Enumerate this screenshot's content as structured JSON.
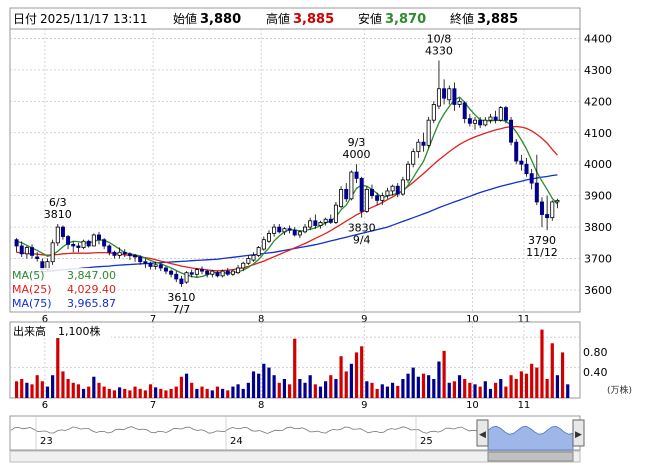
{
  "header": {
    "date_label": "日付",
    "date_value": "2025/11/17 13:11",
    "open_label": "始値",
    "open_value": "3,880",
    "high_label": "高値",
    "high_value": "3,885",
    "low_label": "安値",
    "low_value": "3,870",
    "close_label": "終値",
    "close_value": "3,885"
  },
  "colors": {
    "up": "#d00000",
    "down": "#00008b",
    "ma5": "#2e8b2e",
    "ma25": "#e02020",
    "ma75": "#1030d0",
    "grid": "#c8c8c8",
    "navigator_fill": "#9fb6e8"
  },
  "chart_data": [
    {
      "type": "candlestick",
      "x_months": [
        "6",
        "7",
        "8",
        "9",
        "10",
        "11"
      ],
      "y_ticks": [
        3600,
        3700,
        3800,
        3900,
        4000,
        4100,
        4200,
        4300,
        4400
      ],
      "ylim": [
        3530,
        4430
      ],
      "grid": true,
      "legend": [
        {
          "name": "MA(5)",
          "value": "3,847.00"
        },
        {
          "name": "MA(25)",
          "value": "4,029.40"
        },
        {
          "name": "MA(75)",
          "value": "3,965.87"
        }
      ],
      "annotations": [
        {
          "date": "6/3",
          "value": "3810",
          "position": "above"
        },
        {
          "date": "7/7",
          "value": "3610",
          "position": "below"
        },
        {
          "date": "9/3",
          "value": "4000",
          "position": "above"
        },
        {
          "date": "9/4",
          "value": "3830",
          "position": "below"
        },
        {
          "date": "10/8",
          "value": "4330",
          "position": "above"
        },
        {
          "date": "11/12",
          "value": "3790",
          "position": "below"
        }
      ],
      "candles": [
        [
          3760,
          3765,
          3720,
          3740
        ],
        [
          3740,
          3755,
          3705,
          3715
        ],
        [
          3715,
          3740,
          3700,
          3735
        ],
        [
          3735,
          3745,
          3700,
          3710
        ],
        [
          3705,
          3720,
          3690,
          3700
        ],
        [
          3690,
          3700,
          3650,
          3665
        ],
        [
          3665,
          3700,
          3660,
          3690
        ],
        [
          3690,
          3760,
          3680,
          3750
        ],
        [
          3750,
          3810,
          3740,
          3800
        ],
        [
          3800,
          3805,
          3760,
          3770
        ],
        [
          3770,
          3775,
          3730,
          3745
        ],
        [
          3745,
          3755,
          3720,
          3740
        ],
        [
          3740,
          3750,
          3720,
          3735
        ],
        [
          3735,
          3760,
          3730,
          3755
        ],
        [
          3755,
          3760,
          3735,
          3740
        ],
        [
          3740,
          3780,
          3740,
          3775
        ],
        [
          3775,
          3785,
          3745,
          3760
        ],
        [
          3760,
          3765,
          3730,
          3740
        ],
        [
          3740,
          3745,
          3710,
          3720
        ],
        [
          3720,
          3725,
          3700,
          3710
        ],
        [
          3710,
          3735,
          3700,
          3720
        ],
        [
          3720,
          3730,
          3705,
          3715
        ],
        [
          3715,
          3720,
          3695,
          3710
        ],
        [
          3710,
          3715,
          3690,
          3705
        ],
        [
          3705,
          3710,
          3680,
          3690
        ],
        [
          3690,
          3700,
          3670,
          3685
        ],
        [
          3685,
          3690,
          3665,
          3675
        ],
        [
          3675,
          3690,
          3665,
          3680
        ],
        [
          3680,
          3685,
          3660,
          3670
        ],
        [
          3670,
          3675,
          3650,
          3660
        ],
        [
          3660,
          3665,
          3640,
          3650
        ],
        [
          3650,
          3660,
          3625,
          3635
        ],
        [
          3635,
          3645,
          3610,
          3620
        ],
        [
          3625,
          3660,
          3620,
          3655
        ],
        [
          3655,
          3665,
          3640,
          3650
        ],
        [
          3650,
          3670,
          3640,
          3665
        ],
        [
          3665,
          3675,
          3650,
          3660
        ],
        [
          3660,
          3665,
          3640,
          3650
        ],
        [
          3650,
          3665,
          3640,
          3660
        ],
        [
          3655,
          3660,
          3640,
          3645
        ],
        [
          3645,
          3665,
          3640,
          3660
        ],
        [
          3660,
          3670,
          3645,
          3650
        ],
        [
          3650,
          3665,
          3645,
          3660
        ],
        [
          3655,
          3680,
          3650,
          3670
        ],
        [
          3670,
          3690,
          3660,
          3685
        ],
        [
          3685,
          3710,
          3680,
          3700
        ],
        [
          3695,
          3720,
          3690,
          3710
        ],
        [
          3710,
          3740,
          3705,
          3735
        ],
        [
          3730,
          3770,
          3725,
          3760
        ],
        [
          3755,
          3790,
          3750,
          3780
        ],
        [
          3780,
          3810,
          3770,
          3800
        ],
        [
          3800,
          3810,
          3780,
          3785
        ],
        [
          3785,
          3800,
          3775,
          3795
        ],
        [
          3795,
          3805,
          3780,
          3790
        ],
        [
          3790,
          3800,
          3770,
          3775
        ],
        [
          3775,
          3790,
          3765,
          3785
        ],
        [
          3785,
          3810,
          3780,
          3800
        ],
        [
          3800,
          3830,
          3790,
          3820
        ],
        [
          3820,
          3840,
          3795,
          3805
        ],
        [
          3805,
          3820,
          3795,
          3815
        ],
        [
          3815,
          3830,
          3805,
          3825
        ],
        [
          3825,
          3840,
          3810,
          3815
        ],
        [
          3815,
          3880,
          3810,
          3870
        ],
        [
          3865,
          3930,
          3860,
          3920
        ],
        [
          3920,
          3940,
          3880,
          3890
        ],
        [
          3890,
          3980,
          3885,
          3975
        ],
        [
          3975,
          4000,
          3940,
          3955
        ],
        [
          3955,
          3960,
          3830,
          3850
        ],
        [
          3850,
          3930,
          3845,
          3920
        ],
        [
          3920,
          3935,
          3890,
          3900
        ],
        [
          3900,
          3910,
          3870,
          3885
        ],
        [
          3885,
          3910,
          3870,
          3900
        ],
        [
          3900,
          3925,
          3890,
          3915
        ],
        [
          3915,
          3935,
          3900,
          3930
        ],
        [
          3930,
          3940,
          3895,
          3905
        ],
        [
          3905,
          3960,
          3900,
          3950
        ],
        [
          3950,
          4010,
          3940,
          4000
        ],
        [
          4000,
          4050,
          3990,
          4040
        ],
        [
          4040,
          4080,
          4020,
          4070
        ],
        [
          4070,
          4100,
          4040,
          4060
        ],
        [
          4060,
          4150,
          4050,
          4140
        ],
        [
          4140,
          4200,
          4130,
          4190
        ],
        [
          4185,
          4330,
          4175,
          4240
        ],
        [
          4240,
          4270,
          4190,
          4210
        ],
        [
          4205,
          4250,
          4190,
          4240
        ],
        [
          4240,
          4260,
          4170,
          4190
        ],
        [
          4190,
          4210,
          4180,
          4200
        ],
        [
          4195,
          4200,
          4130,
          4145
        ],
        [
          4145,
          4160,
          4120,
          4130
        ],
        [
          4130,
          4150,
          4110,
          4140
        ],
        [
          4140,
          4150,
          4115,
          4125
        ],
        [
          4125,
          4150,
          4120,
          4140
        ],
        [
          4140,
          4160,
          4130,
          4150
        ],
        [
          4150,
          4170,
          4130,
          4140
        ],
        [
          4140,
          4185,
          4135,
          4180
        ],
        [
          4180,
          4185,
          4130,
          4140
        ],
        [
          4140,
          4150,
          4060,
          4070
        ],
        [
          4070,
          4080,
          4000,
          4010
        ],
        [
          4010,
          4030,
          3980,
          4000
        ],
        [
          4000,
          4020,
          3960,
          3970
        ],
        [
          3970,
          3985,
          3920,
          3940
        ],
        [
          3940,
          4030,
          3870,
          3880
        ],
        [
          3880,
          3895,
          3800,
          3840
        ],
        [
          3840,
          3900,
          3790,
          3830
        ],
        [
          3830,
          3885,
          3820,
          3880
        ],
        [
          3880,
          3890,
          3860,
          3885
        ]
      ],
      "ma5": [
        3755,
        3750,
        3742,
        3734,
        3726,
        3717,
        3707,
        3712,
        3723,
        3737,
        3749,
        3755,
        3754,
        3750,
        3749,
        3755,
        3759,
        3758,
        3751,
        3741,
        3730,
        3719,
        3715,
        3712,
        3708,
        3701,
        3694,
        3688,
        3683,
        3677,
        3670,
        3662,
        3654,
        3648,
        3643,
        3640,
        3643,
        3648,
        3655,
        3656,
        3655,
        3654,
        3655,
        3658,
        3663,
        3672,
        3683,
        3697,
        3716,
        3734,
        3756,
        3772,
        3784,
        3792,
        3791,
        3788,
        3789,
        3793,
        3797,
        3805,
        3813,
        3820,
        3832,
        3855,
        3870,
        3897,
        3923,
        3934,
        3930,
        3920,
        3907,
        3894,
        3899,
        3903,
        3908,
        3914,
        3933,
        3957,
        3984,
        4009,
        4051,
        4093,
        4132,
        4160,
        4184,
        4205,
        4213,
        4197,
        4175,
        4157,
        4141,
        4138,
        4138,
        4139,
        4140,
        4137,
        4123,
        4103,
        4077,
        4048,
        4012,
        3975,
        3946,
        3920,
        3891,
        3873
      ],
      "ma25": [
        3720,
        3718,
        3716,
        3715,
        3714,
        3712,
        3711,
        3712,
        3713,
        3715,
        3716,
        3717,
        3717,
        3717,
        3717,
        3718,
        3719,
        3719,
        3718,
        3716,
        3714,
        3712,
        3710,
        3708,
        3705,
        3703,
        3700,
        3696,
        3692,
        3688,
        3684,
        3680,
        3676,
        3673,
        3670,
        3668,
        3666,
        3664,
        3662,
        3661,
        3662,
        3663,
        3665,
        3668,
        3671,
        3675,
        3680,
        3686,
        3692,
        3699,
        3706,
        3713,
        3720,
        3727,
        3734,
        3741,
        3748,
        3756,
        3764,
        3772,
        3780,
        3789,
        3799,
        3809,
        3819,
        3829,
        3839,
        3847,
        3855,
        3863,
        3870,
        3878,
        3887,
        3896,
        3906,
        3917,
        3929,
        3942,
        3956,
        3970,
        3985,
        4000,
        4014,
        4027,
        4040,
        4052,
        4063,
        4072,
        4080,
        4087,
        4093,
        4099,
        4104,
        4109,
        4113,
        4117,
        4119,
        4120,
        4118,
        4114,
        4106,
        4095,
        4082,
        4067,
        4047,
        4029
      ],
      "ma75": [
        3650,
        3652,
        3654,
        3656,
        3657,
        3658,
        3660,
        3661,
        3663,
        3664,
        3666,
        3667,
        3668,
        3670,
        3671,
        3673,
        3674,
        3675,
        3676,
        3678,
        3679,
        3680,
        3681,
        3682,
        3683,
        3684,
        3685,
        3686,
        3687,
        3688,
        3689,
        3690,
        3691,
        3692,
        3693,
        3694,
        3695,
        3696,
        3697,
        3698,
        3700,
        3702,
        3704,
        3706,
        3708,
        3710,
        3712,
        3714,
        3716,
        3718,
        3720,
        3723,
        3726,
        3729,
        3732,
        3735,
        3738,
        3741,
        3744,
        3748,
        3752,
        3756,
        3760,
        3764,
        3768,
        3772,
        3776,
        3780,
        3784,
        3788,
        3792,
        3796,
        3800,
        3806,
        3812,
        3818,
        3824,
        3830,
        3836,
        3842,
        3848,
        3855,
        3862,
        3868,
        3874,
        3880,
        3886,
        3892,
        3898,
        3904,
        3910,
        3915,
        3920,
        3925,
        3930,
        3934,
        3938,
        3942,
        3946,
        3950,
        3953,
        3956,
        3959,
        3961,
        3964,
        3966
      ]
    },
    {
      "type": "bar",
      "title": "出来高",
      "current_label": "1,100株",
      "y_ticks": [
        0.4,
        0.8
      ],
      "unit": "(万株)",
      "ylim": [
        0,
        1.0
      ],
      "values": [
        0.22,
        0.25,
        0.2,
        0.18,
        0.3,
        0.22,
        0.15,
        0.3,
        0.88,
        0.35,
        0.25,
        0.2,
        0.18,
        0.12,
        0.15,
        0.28,
        0.2,
        0.15,
        0.12,
        0.1,
        0.14,
        0.12,
        0.1,
        0.15,
        0.12,
        0.1,
        0.18,
        0.14,
        0.12,
        0.1,
        0.12,
        0.15,
        0.28,
        0.32,
        0.2,
        0.12,
        0.15,
        0.12,
        0.1,
        0.15,
        0.12,
        0.1,
        0.15,
        0.18,
        0.12,
        0.2,
        0.35,
        0.32,
        0.45,
        0.4,
        0.3,
        0.2,
        0.25,
        0.18,
        0.78,
        0.25,
        0.2,
        0.3,
        0.18,
        0.15,
        0.22,
        0.3,
        0.25,
        0.55,
        0.35,
        0.45,
        0.6,
        0.68,
        0.22,
        0.2,
        0.12,
        0.18,
        0.15,
        0.2,
        0.16,
        0.25,
        0.32,
        0.4,
        0.28,
        0.32,
        0.3,
        0.25,
        0.48,
        0.62,
        0.2,
        0.22,
        0.3,
        0.25,
        0.2,
        0.18,
        0.15,
        0.22,
        0.12,
        0.2,
        0.25,
        0.15,
        0.3,
        0.25,
        0.35,
        0.32,
        0.45,
        0.4,
        0.9,
        0.25,
        0.72,
        0.3,
        0.6,
        0.18
      ]
    }
  ],
  "navigator": {
    "years": [
      "23",
      "24",
      "25"
    ],
    "left_arrow": "◀",
    "right_arrow": "▶"
  }
}
